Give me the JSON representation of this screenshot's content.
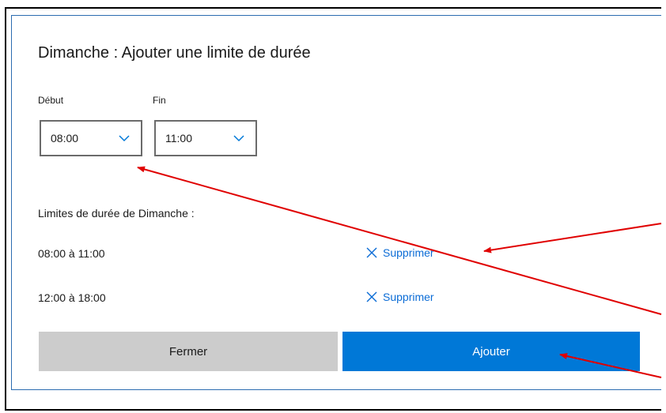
{
  "dialog": {
    "title": "Dimanche : Ajouter une limite de durée"
  },
  "start": {
    "label": "Début",
    "value": "08:00"
  },
  "end": {
    "label": "Fin",
    "value": "11:00"
  },
  "limits": {
    "heading": "Limites de durée de Dimanche :",
    "items": [
      {
        "range": "08:00 à 11:00",
        "delete_label": "Supprimer"
      },
      {
        "range": "12:00 à 18:00",
        "delete_label": "Supprimer"
      }
    ]
  },
  "buttons": {
    "close_label": "Fermer",
    "add_label": "Ajouter"
  },
  "colors": {
    "accent": "#0078d7",
    "link": "#0b6cd6",
    "annotation_arrow": "#e00000"
  },
  "icons": {
    "dropdown": "chevron-down-icon",
    "delete": "close-x-icon"
  }
}
